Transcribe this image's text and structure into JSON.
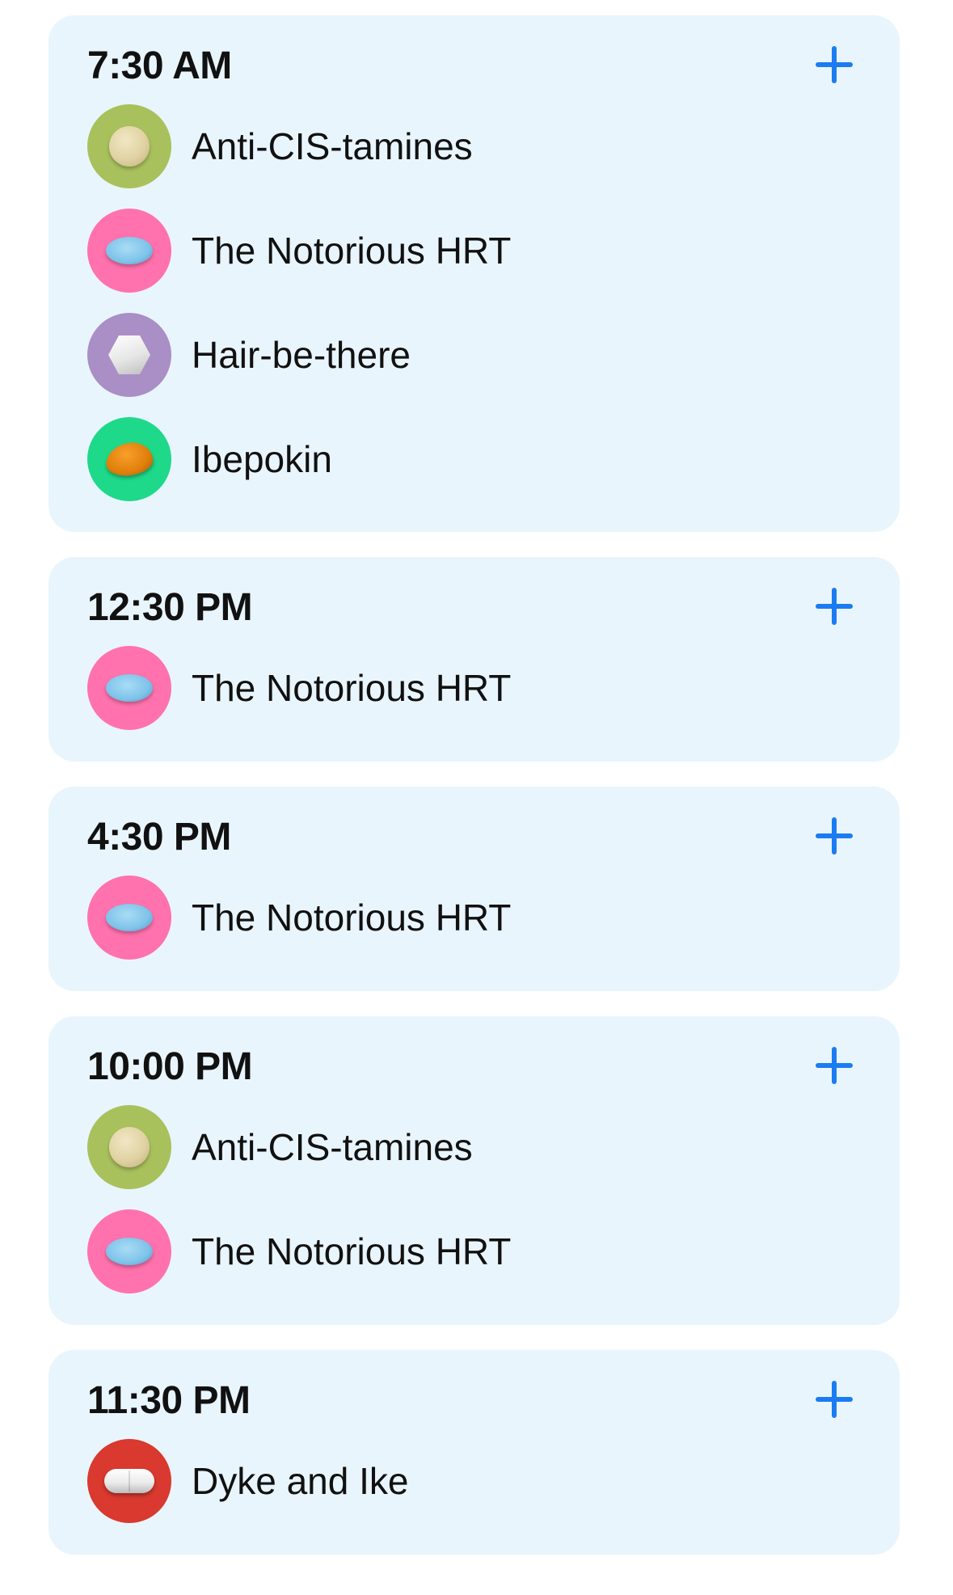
{
  "schedule": [
    {
      "time": "7:30 AM",
      "medications": [
        {
          "name": "Anti-CIS-tamines",
          "icon": "round-beige-pill-icon",
          "color": "#a8c15c"
        },
        {
          "name": "The Notorious HRT",
          "icon": "oval-blue-pill-icon",
          "color": "#ff72ad"
        },
        {
          "name": "Hair-be-there",
          "icon": "hexagon-white-pill-icon",
          "color": "#a98fc6"
        },
        {
          "name": "Ibepokin",
          "icon": "orange-pill-icon",
          "color": "#1fd98a"
        }
      ]
    },
    {
      "time": "12:30 PM",
      "medications": [
        {
          "name": "The Notorious HRT",
          "icon": "oval-blue-pill-icon",
          "color": "#ff72ad"
        }
      ]
    },
    {
      "time": "4:30 PM",
      "medications": [
        {
          "name": "The Notorious HRT",
          "icon": "oval-blue-pill-icon",
          "color": "#ff72ad"
        }
      ]
    },
    {
      "time": "10:00 PM",
      "medications": [
        {
          "name": "Anti-CIS-tamines",
          "icon": "round-beige-pill-icon",
          "color": "#a8c15c"
        },
        {
          "name": "The Notorious HRT",
          "icon": "oval-blue-pill-icon",
          "color": "#ff72ad"
        }
      ]
    },
    {
      "time": "11:30 PM",
      "medications": [
        {
          "name": "Dyke and Ike",
          "icon": "white-capsule-icon",
          "color": "#d9392e"
        }
      ]
    }
  ],
  "colors": {
    "card_background": "#e9f5fc",
    "accent": "#1b7cf2",
    "text": "#111111"
  },
  "add_icon": "plus-icon"
}
